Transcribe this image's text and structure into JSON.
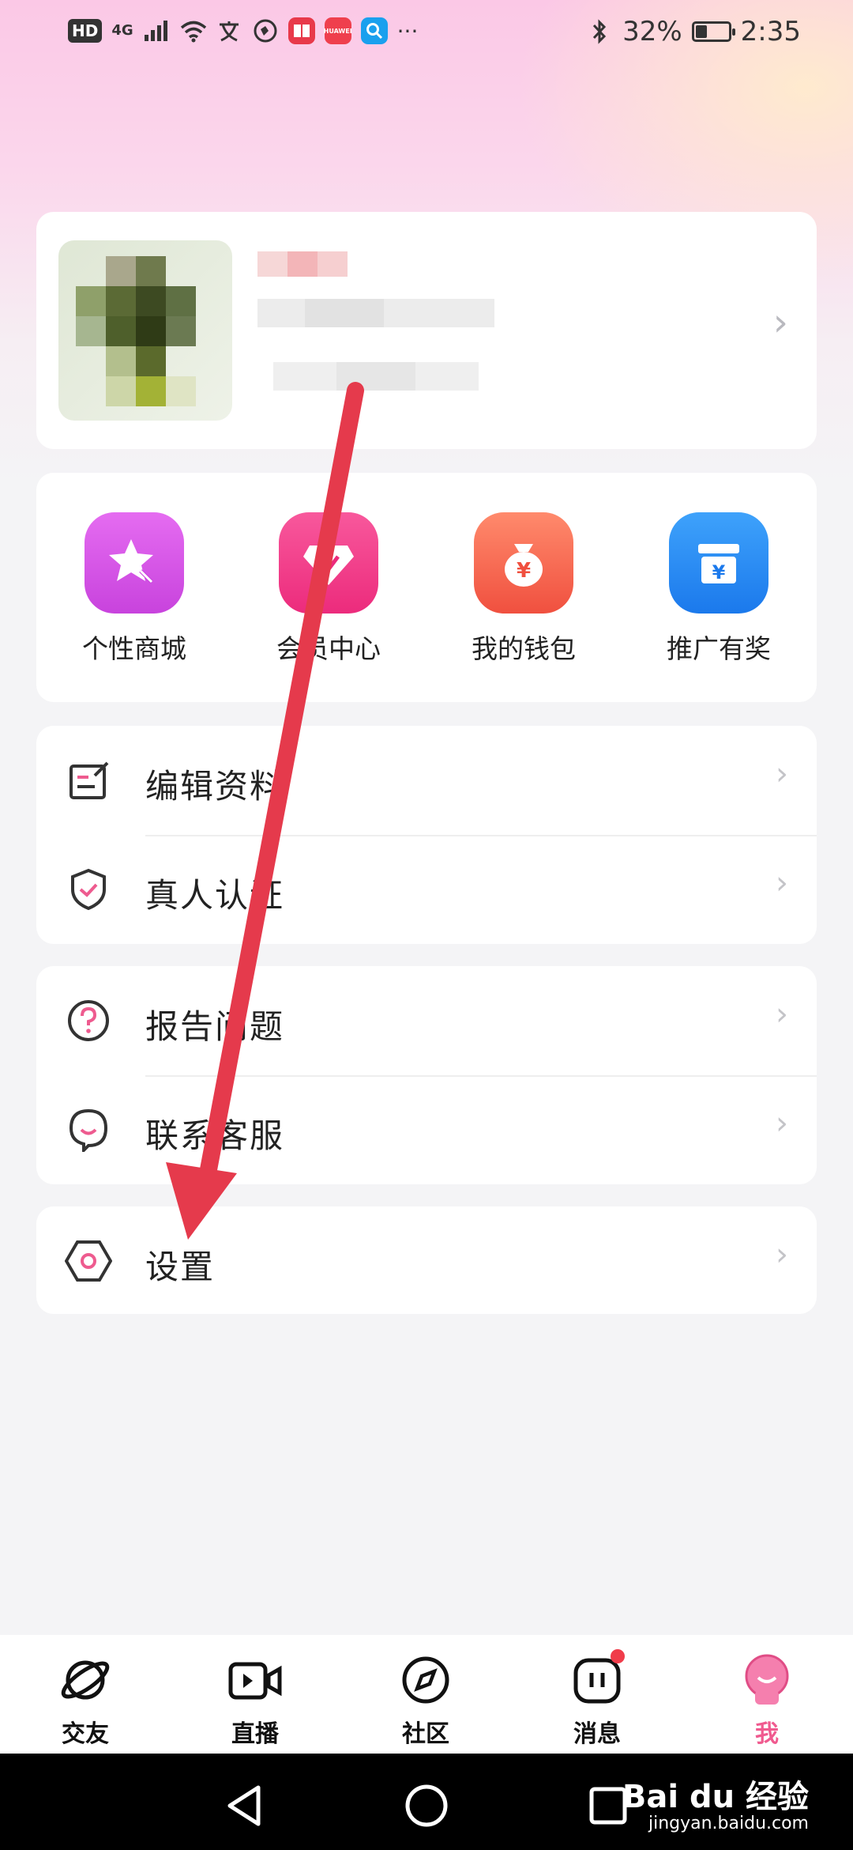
{
  "status_bar": {
    "hd": "HD",
    "network": "4G",
    "battery_text": "32%",
    "battery_level": 0.32,
    "time": "2:35",
    "more": "···",
    "huawei": "HUAWEI"
  },
  "shortcuts": [
    {
      "label": "个性商城",
      "icon": "star-wand-icon",
      "color": "#d752e4"
    },
    {
      "label": "会员中心",
      "icon": "diamond-icon",
      "color": "#f2428d"
    },
    {
      "label": "我的钱包",
      "icon": "money-bag-icon",
      "color": "#f4604b"
    },
    {
      "label": "推广有奖",
      "icon": "gift-box-icon",
      "color": "#2e8cf5"
    }
  ],
  "menu_groups": [
    {
      "items": [
        {
          "label": "编辑资料",
          "icon": "edit-profile-icon"
        },
        {
          "label": "真人认证",
          "icon": "shield-check-icon"
        }
      ]
    },
    {
      "items": [
        {
          "label": "报告问题",
          "icon": "question-icon"
        },
        {
          "label": "联系客服",
          "icon": "customer-service-icon"
        }
      ]
    },
    {
      "items": [
        {
          "label": "设置",
          "icon": "settings-icon"
        }
      ]
    }
  ],
  "bottom_nav": [
    {
      "label": "交友",
      "icon": "planet-icon"
    },
    {
      "label": "直播",
      "icon": "video-camera-icon"
    },
    {
      "label": "社区",
      "icon": "compass-icon"
    },
    {
      "label": "消息",
      "icon": "message-icon",
      "badge": true
    },
    {
      "label": "我",
      "icon": "me-avatar-icon",
      "active": true
    }
  ],
  "watermark": {
    "brand": "Bai du 经验",
    "url": "jingyan.baidu.com"
  },
  "colors": {
    "accent": "#f05a8f",
    "arrow": "#e53a4c"
  }
}
